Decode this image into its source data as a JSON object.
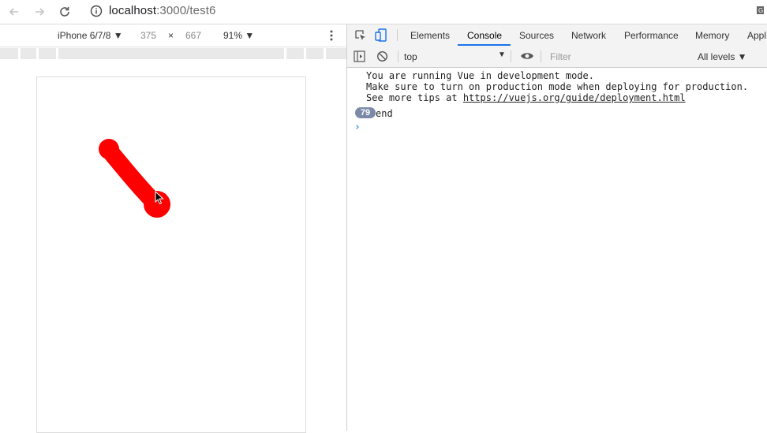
{
  "browser": {
    "url_host": "localhost",
    "url_path": ":3000/test6"
  },
  "device_toolbar": {
    "device": "iPhone 6/7/8 ▼",
    "width": "375",
    "separator": "×",
    "height": "667",
    "zoom": "91% ▼"
  },
  "devtools": {
    "tabs": [
      "Elements",
      "Console",
      "Sources",
      "Network",
      "Performance",
      "Memory",
      "Appl"
    ],
    "active_tab": "Console",
    "context": "top",
    "filter_placeholder": "Filter",
    "levels": "All levels ▼"
  },
  "console": {
    "vue_line1": "You are running Vue in development mode.",
    "vue_line2": "Make sure to turn on production mode when deploying for production.",
    "vue_line3_prefix": "See more tips at ",
    "vue_link": "https://vuejs.org/guide/deployment.html",
    "log_count": "79",
    "log_text": "end",
    "prompt": "›"
  },
  "colors": {
    "shape": "#ff0000",
    "accent": "#1a73e8"
  }
}
